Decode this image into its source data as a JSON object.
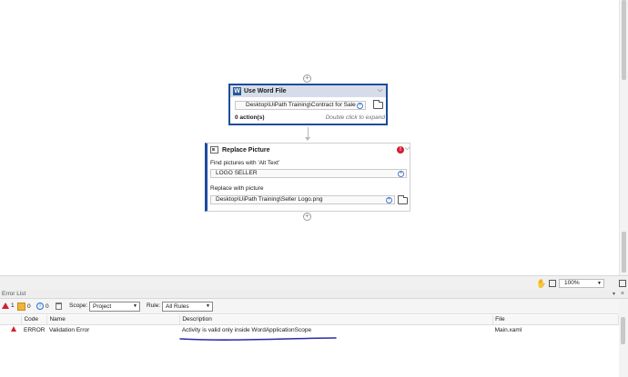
{
  "designer": {
    "word_card": {
      "title": "Use Word File",
      "badge": "W",
      "path_prefix": "Desktop",
      "path_value": "\\UiPath Training\\Contract for Sale ...",
      "actions": "0 action(s)",
      "hint": "Double click to expand"
    },
    "replace_card": {
      "title": "Replace Picture",
      "error_mark": "!",
      "find_label": "Find pictures with 'Alt Text'",
      "find_value": "LOGO SELLER",
      "replace_label": "Replace with picture",
      "replace_prefix": "Desktop",
      "replace_value": "\\UiPath Training\\Seller Logo.png"
    }
  },
  "canvas_tools": {
    "zoom": "100%"
  },
  "error_panel": {
    "title": "Error List",
    "errors_count": "1",
    "warnings_count": "0",
    "info_count": "0",
    "scope_label": "Scope:",
    "scope_value": "Project",
    "rule_label": "Rule:",
    "rule_value": "All Rules",
    "columns": [
      "Code",
      "Name",
      "Description",
      "File"
    ],
    "rows": [
      {
        "code": "ERROR",
        "name": "Validation Error",
        "description": "Activity is valid only inside WordApplicationScope",
        "file": "Main.xaml"
      }
    ]
  },
  "colors": {
    "accent": "#1d4c9c",
    "error": "#d1202f",
    "annotation": "#2a2aa8"
  }
}
